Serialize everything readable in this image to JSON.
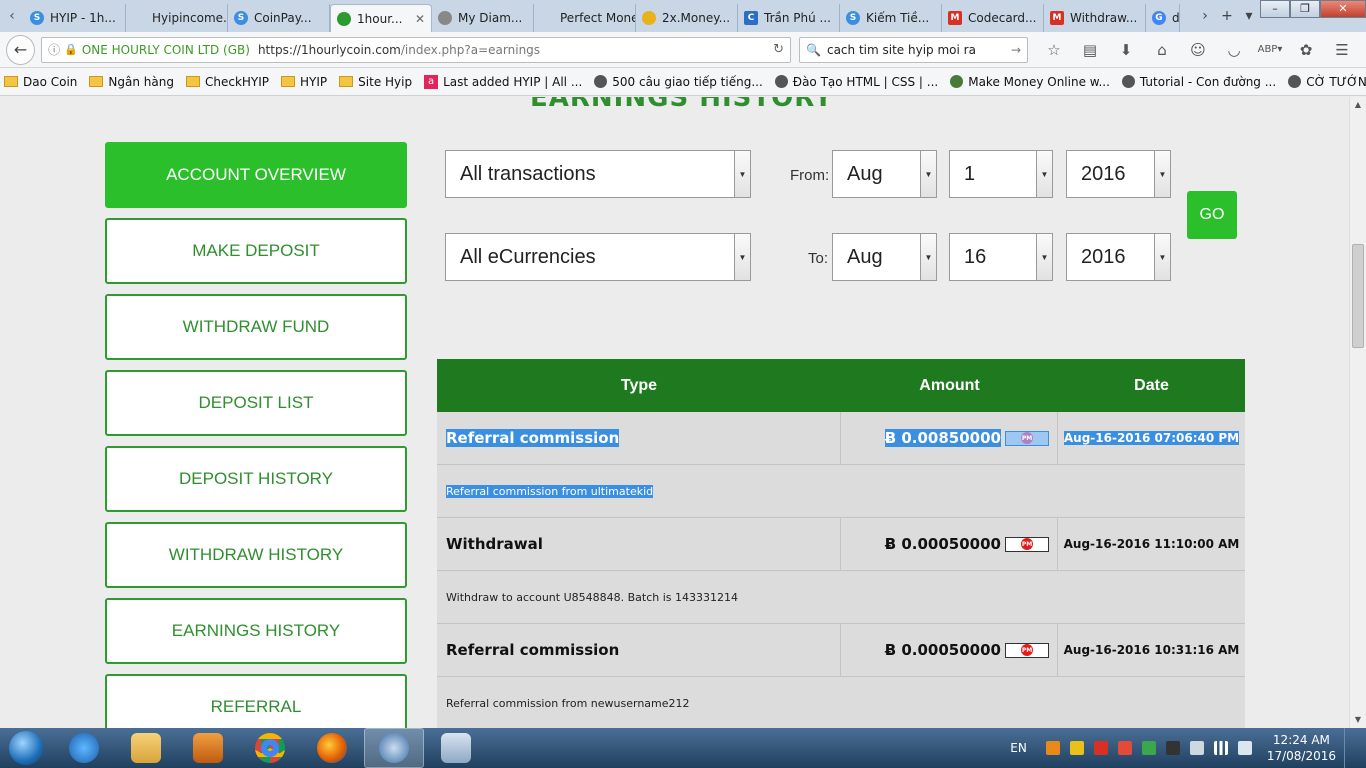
{
  "browser": {
    "tabs": [
      {
        "label": "HYIP - 1h...",
        "color": "#3b8fe0"
      },
      {
        "label": "Hyipincome...",
        "color": ""
      },
      {
        "label": "CoinPay...",
        "color": "#3b8fe0"
      },
      {
        "label": "1hour...",
        "color": "#2c9a2c",
        "active": true
      },
      {
        "label": "My Diam...",
        "color": "#888888"
      },
      {
        "label": "Perfect Mone...",
        "color": ""
      },
      {
        "label": "2x.Money...",
        "color": "#e8b21a"
      },
      {
        "label": "Trần Phú ...",
        "color": "#2a6fc4"
      },
      {
        "label": "Kiếm Tiề...",
        "color": "#3b8fe0"
      },
      {
        "label": "Codecard...",
        "color": "#d93025"
      },
      {
        "label": "Withdraw...",
        "color": "#d93025"
      },
      {
        "label": "d",
        "color": "#4285f4"
      }
    ],
    "site_identity": "ONE HOURLY COIN LTD (GB)",
    "url_host": "https://1hourlycoin.com",
    "url_path": "/index.php?a=earnings",
    "search_query": "cach tim site hyip moi ra",
    "bookmarks": [
      {
        "label": "Dao Coin",
        "icon": "folder"
      },
      {
        "label": "Ngân hàng",
        "icon": "folder"
      },
      {
        "label": "CheckHYIP",
        "icon": "folder"
      },
      {
        "label": "HYIP",
        "icon": "folder"
      },
      {
        "label": "Site Hyip",
        "icon": "folder"
      },
      {
        "label": "Last added HYIP | All ...",
        "icon": "a"
      },
      {
        "label": "500 câu giao tiếp tiếng...",
        "icon": "globe"
      },
      {
        "label": "Đào Tạo HTML | CSS | ...",
        "icon": "globe"
      },
      {
        "label": "Make Money Online w...",
        "icon": "globe"
      },
      {
        "label": "Tutorial - Con đường ...",
        "icon": "globe"
      },
      {
        "label": "CỜ TƯỚNG: CHUYÊN ...",
        "icon": "globe"
      }
    ]
  },
  "page": {
    "heading": "EARNINGS HISTORY",
    "sidebar": [
      {
        "label": "ACCOUNT OVERVIEW",
        "active": true
      },
      {
        "label": "MAKE DEPOSIT"
      },
      {
        "label": "WITHDRAW FUND"
      },
      {
        "label": "DEPOSIT LIST"
      },
      {
        "label": "DEPOSIT HISTORY"
      },
      {
        "label": "WITHDRAW HISTORY"
      },
      {
        "label": "EARNINGS HISTORY"
      },
      {
        "label": "REFERRAL"
      }
    ],
    "filters": {
      "type_value": "All transactions",
      "currency_value": "All eCurrencies",
      "from_label": "From:",
      "to_label": "To:",
      "from_month": "Aug",
      "from_day": "1",
      "from_year": "2016",
      "to_month": "Aug",
      "to_day": "16",
      "to_year": "2016",
      "go_label": "GO"
    },
    "table": {
      "headers": [
        "Type",
        "Amount",
        "Date"
      ],
      "pm_badge": "PM",
      "rows": [
        {
          "type": "Referral commission",
          "amount": "Ƀ 0.00850000",
          "date": "Aug-16-2016 07:06:40 PM",
          "desc": "Referral commission from ultimatekid",
          "selected": true
        },
        {
          "type": "Withdrawal",
          "amount": "Ƀ 0.00050000",
          "date": "Aug-16-2016 11:10:00 AM",
          "desc": "Withdraw to account U8548848. Batch is 143331214"
        },
        {
          "type": "Referral commission",
          "amount": "Ƀ 0.00050000",
          "date": "Aug-16-2016 10:31:16 AM",
          "desc": "Referral commission from newusername212"
        }
      ]
    }
  },
  "taskbar": {
    "language": "EN",
    "time": "12:24 AM",
    "date": "17/08/2016"
  },
  "colors": {
    "accent_green": "#2cbf2c",
    "header_green": "#1f7a1f",
    "selection_blue": "#3b8fe0"
  }
}
